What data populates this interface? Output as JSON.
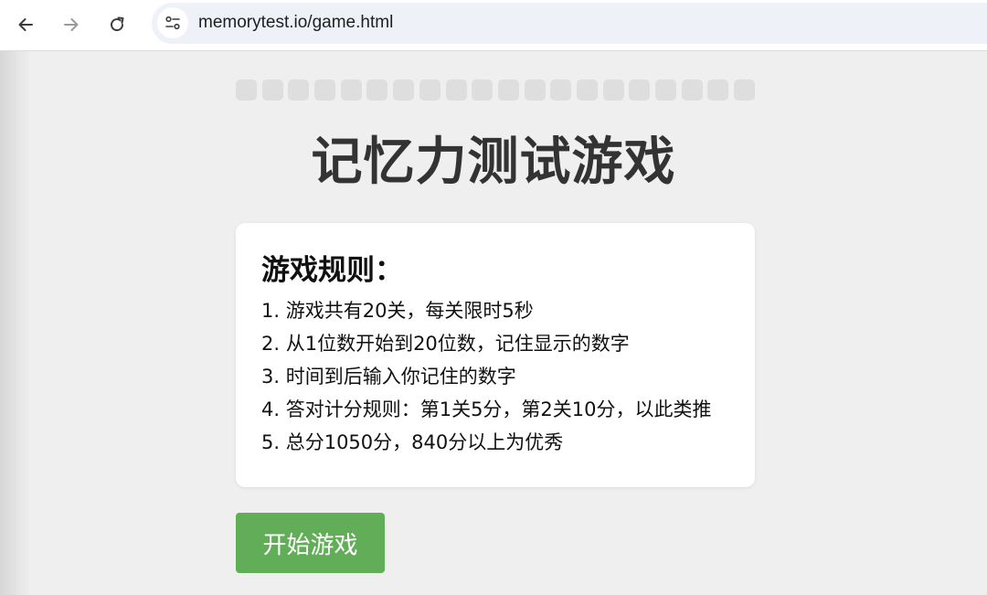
{
  "browser": {
    "url": "memorytest.io/game.html"
  },
  "game": {
    "progress": {
      "total_levels": 20,
      "completed": 0
    },
    "title": "记忆力测试游戏",
    "rules": {
      "heading": "游戏规则：",
      "items": [
        "1. 游戏共有20关，每关限时5秒",
        "2. 从1位数开始到20位数，记住显示的数字",
        "3. 时间到后输入你记住的数字",
        "4. 答对计分规则：第1关5分，第2关10分，以此类推",
        "5. 总分1050分，840分以上为优秀"
      ]
    },
    "start_button": "开始游戏"
  },
  "colors": {
    "accent_green": "#62ae58",
    "progress_segment": "#dedede",
    "page_background": "#efefef"
  },
  "icons": [
    "back-arrow-icon",
    "forward-arrow-icon",
    "reload-icon",
    "site-settings-icon"
  ]
}
